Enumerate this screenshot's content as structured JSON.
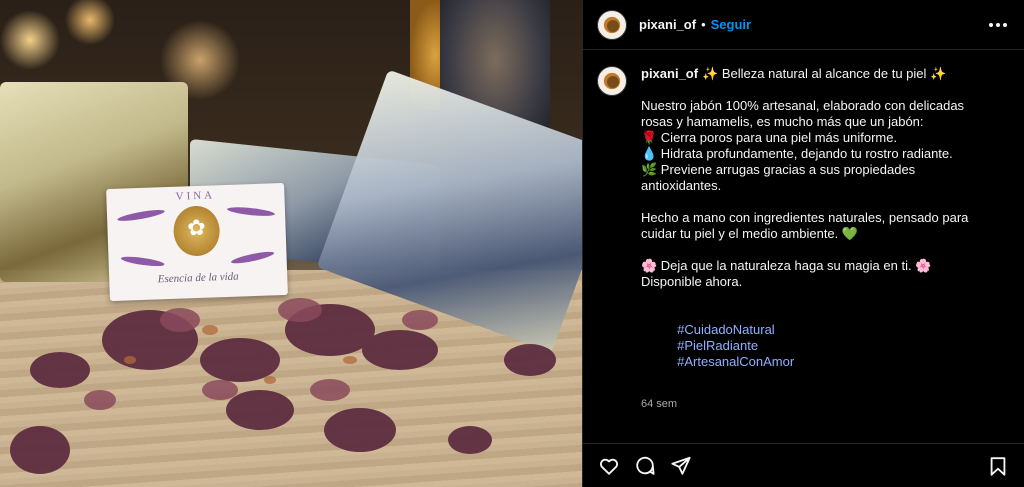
{
  "header": {
    "username": "pixani_of",
    "separator": "•",
    "follow_label": "Seguir",
    "more_icon": "more-horizontal-icon"
  },
  "photo": {
    "card_brand": "VINA",
    "card_tagline": "Esencia de la vida"
  },
  "caption": {
    "username": "pixani_of",
    "lines": [
      "✨ Belleza natural al alcance de tu piel ✨",
      "",
      "Nuestro jabón 100% artesanal, elaborado con delicadas rosas y hamamelis, es mucho más que un jabón:",
      "🌹 Cierra poros para una piel más uniforme.",
      "💧 Hidrata profundamente, dejando tu rostro radiante.",
      "🌿 Previene arrugas gracias a sus propiedades antioxidantes.",
      "",
      "Hecho a mano con ingredientes naturales, pensado para cuidar tu piel y el medio ambiente. 💚",
      "",
      "🌸 Deja que la naturaleza haga su magia en ti. 🌸",
      "Disponible ahora."
    ],
    "hashtags": [
      "#CuidadoNatural",
      "#PielRadiante",
      "#ArtesanalConAmor"
    ],
    "time": "64 sem"
  },
  "actions": {
    "like_icon": "heart-icon",
    "comment_icon": "comment-icon",
    "share_icon": "share-icon",
    "save_icon": "bookmark-icon"
  },
  "colors": {
    "accent": "#0095f6",
    "background": "#000000",
    "text": "#f5f5f5",
    "muted": "#a8a8a8",
    "hashtag": "#8fb0ff"
  }
}
